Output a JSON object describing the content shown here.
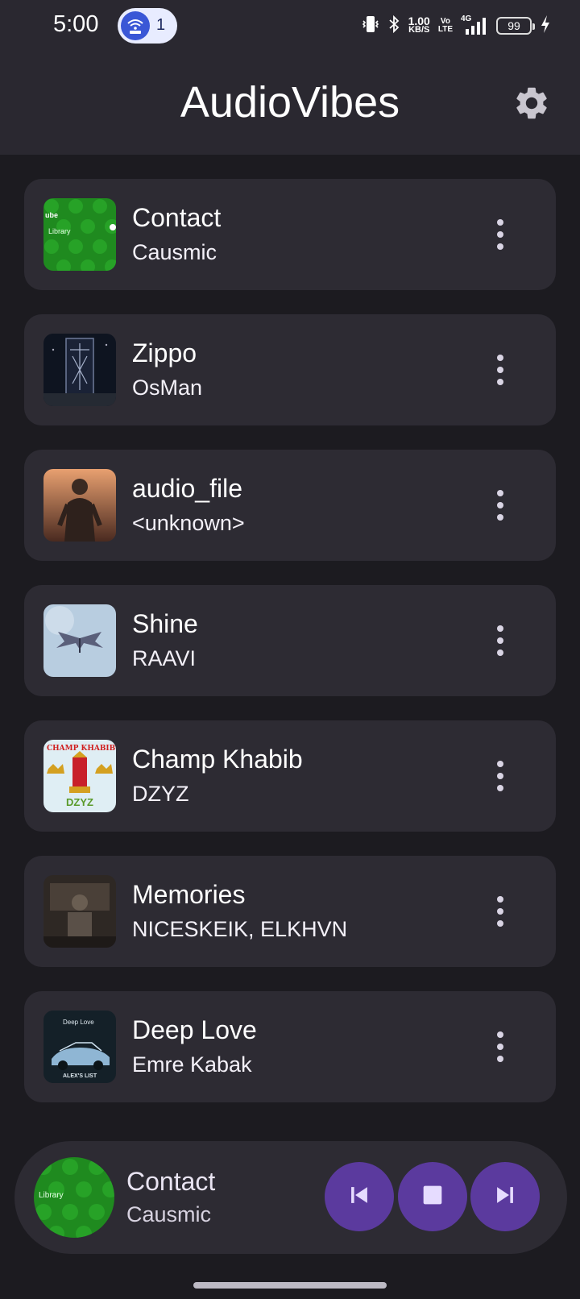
{
  "status_bar": {
    "time": "5:00",
    "hotspot_count": "1",
    "net_speed_value": "1.00",
    "net_speed_unit": "KB/S",
    "volte_top": "Vo",
    "volte_bottom": "LTE",
    "network_type": "4G",
    "battery": "99"
  },
  "header": {
    "title": "AudioVibes",
    "settings_icon": "gear-icon"
  },
  "songs": [
    {
      "title": "Contact",
      "artist": "Causmic"
    },
    {
      "title": "Zippo",
      "artist": "OsMan"
    },
    {
      "title": "audio_file",
      "artist": "<unknown>"
    },
    {
      "title": "Shine",
      "artist": "RAAVI"
    },
    {
      "title": "Champ Khabib",
      "artist": "DZYZ"
    },
    {
      "title": "Memories",
      "artist": "NICESKEIK, ELKHVN"
    },
    {
      "title": "Deep Love",
      "artist": "Emre Kabak"
    }
  ],
  "artwork_text": {
    "contact_top": "ube",
    "contact_mid": "Library",
    "champ_top": "CHAMP KHABIB",
    "champ_bottom": "DZYZ",
    "deep_love_top": "Deep Love",
    "deep_love_bottom": "ALEX'S LIST"
  },
  "now_playing": {
    "title": "Contact",
    "artist": "Causmic",
    "prev_icon": "skip-previous-icon",
    "stop_icon": "stop-icon",
    "next_icon": "skip-next-icon"
  },
  "colors": {
    "background": "#1c1b20",
    "header": "#2a2830",
    "card": "#2d2b33",
    "accent": "#5b3a9e",
    "accent_icon": "#e6dcff"
  }
}
